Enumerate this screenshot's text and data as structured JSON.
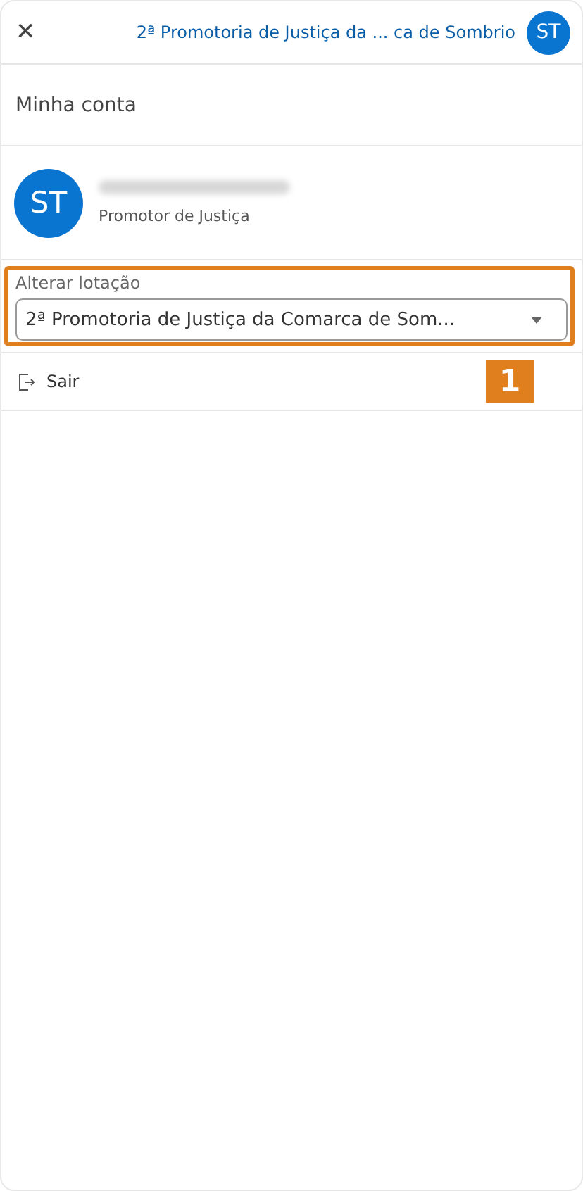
{
  "header": {
    "close": "✕",
    "location": "2ª Promotoria de Justiça da ...  ca de Sombrio",
    "avatar": "ST"
  },
  "section_title": "Minha conta",
  "profile": {
    "avatar": "ST",
    "role": "Promotor de Justiça"
  },
  "location_select": {
    "label": "Alterar lotação",
    "value": "2ª Promotoria de Justiça da Comarca de Som..."
  },
  "annotation": {
    "number": "1"
  },
  "menu": [
    {
      "kind": "logout",
      "label": "Sair"
    }
  ]
}
